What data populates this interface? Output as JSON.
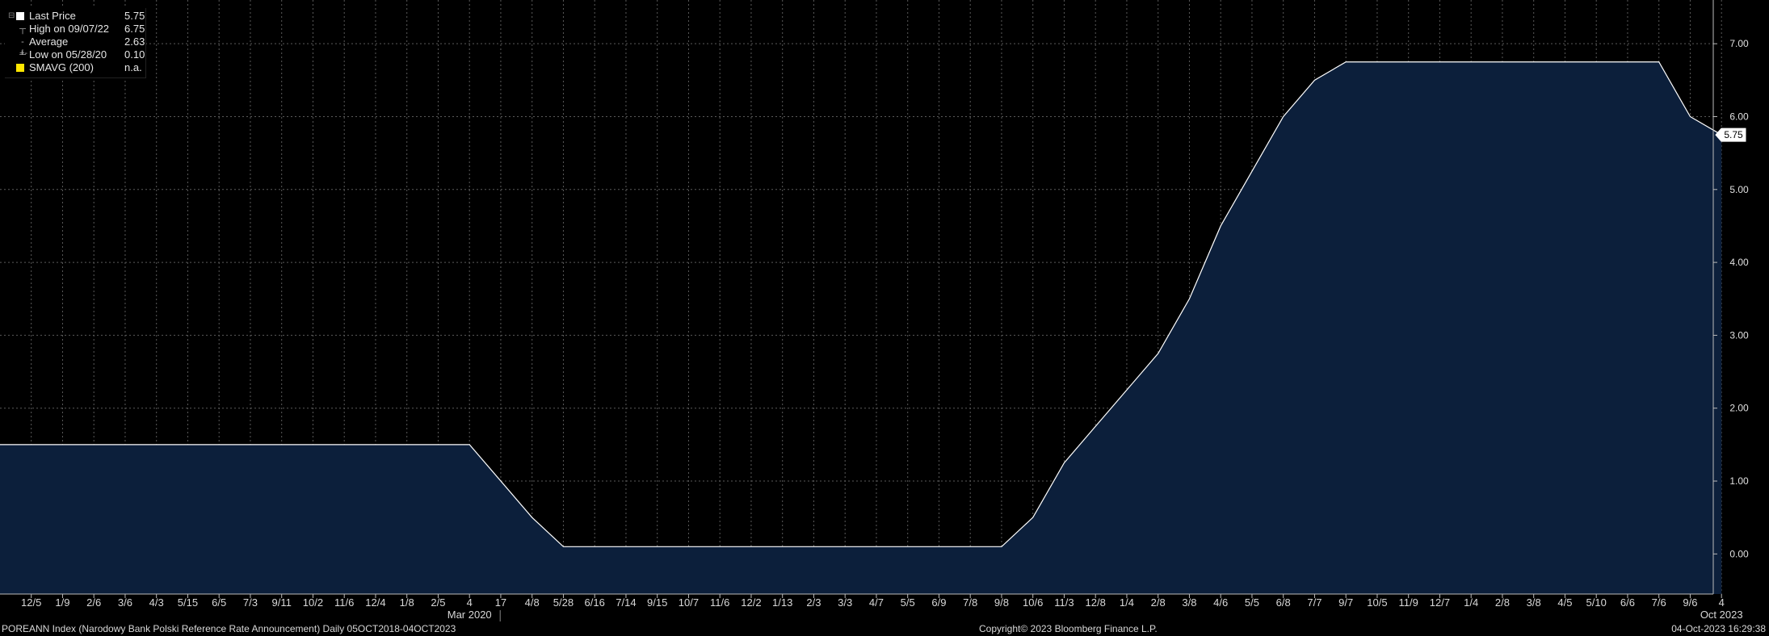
{
  "legend": {
    "items": [
      {
        "label": "Last Price",
        "value": "5.75",
        "marker": "square",
        "color": "#ffffff"
      },
      {
        "label": "High on 09/07/22",
        "value": "6.75",
        "marker": "high-tick"
      },
      {
        "label": "Average",
        "value": "2.63",
        "marker": "average-tick"
      },
      {
        "label": "Low on 05/28/20",
        "value": "0.10",
        "marker": "low-tick"
      },
      {
        "label": "SMAVG (200)",
        "value": "n.a.",
        "marker": "square",
        "color": "#ffe600"
      }
    ]
  },
  "footer": {
    "left": "POREANN Index (Narodowy Bank Polski Reference Rate Announcement)  Daily 05OCT2018-04OCT2023",
    "center": "Copyright© 2023 Bloomberg Finance L.P.",
    "right": "04-Oct-2023 16:29:38"
  },
  "colors": {
    "background": "#000000",
    "area_fill": "#0c1f3b",
    "line": "#ffffff",
    "grid": "#5a5a5a"
  },
  "chart_data": {
    "type": "area",
    "grid": true,
    "y_axis_position": "right",
    "ylim": [
      -0.55,
      7.6
    ],
    "yticks": [
      0,
      1,
      2,
      3,
      4,
      5,
      6,
      7
    ],
    "ytick_labels": [
      "0.00",
      "1.00",
      "2.00",
      "3.00",
      "4.00",
      "5.00",
      "6.00",
      "7.00"
    ],
    "last_value_label": "5.75",
    "x_tick_labels": [
      "12/5",
      "1/9",
      "2/6",
      "3/6",
      "4/3",
      "5/15",
      "6/5",
      "7/3",
      "9/11",
      "10/2",
      "11/6",
      "12/4",
      "1/8",
      "2/5",
      "4",
      "17",
      "4/8",
      "5/28",
      "6/16",
      "7/14",
      "9/15",
      "10/7",
      "11/6",
      "12/2",
      "1/13",
      "2/3",
      "3/3",
      "4/7",
      "5/5",
      "6/9",
      "7/8",
      "9/8",
      "10/6",
      "11/3",
      "12/8",
      "1/4",
      "2/8",
      "3/8",
      "4/6",
      "5/5",
      "6/8",
      "7/7",
      "9/7",
      "10/5",
      "11/9",
      "12/7",
      "1/4",
      "2/8",
      "3/8",
      "4/5",
      "5/10",
      "6/6",
      "7/6",
      "9/6",
      "4"
    ],
    "x_sublabels": [
      {
        "tick_index": 14,
        "label": "Mar 2020"
      },
      {
        "tick_index": 54,
        "label": "Oct 2023"
      }
    ],
    "series": [
      {
        "x": [
          0,
          14,
          16,
          17,
          31,
          32,
          33,
          34,
          35,
          36,
          37,
          38,
          39,
          40,
          41,
          42,
          52,
          53,
          54
        ],
        "y": [
          1.5,
          1.5,
          0.5,
          0.1,
          0.1,
          0.5,
          1.25,
          1.75,
          2.25,
          2.75,
          3.5,
          4.5,
          5.25,
          6.0,
          6.5,
          6.75,
          6.75,
          6.0,
          5.75
        ]
      }
    ]
  }
}
